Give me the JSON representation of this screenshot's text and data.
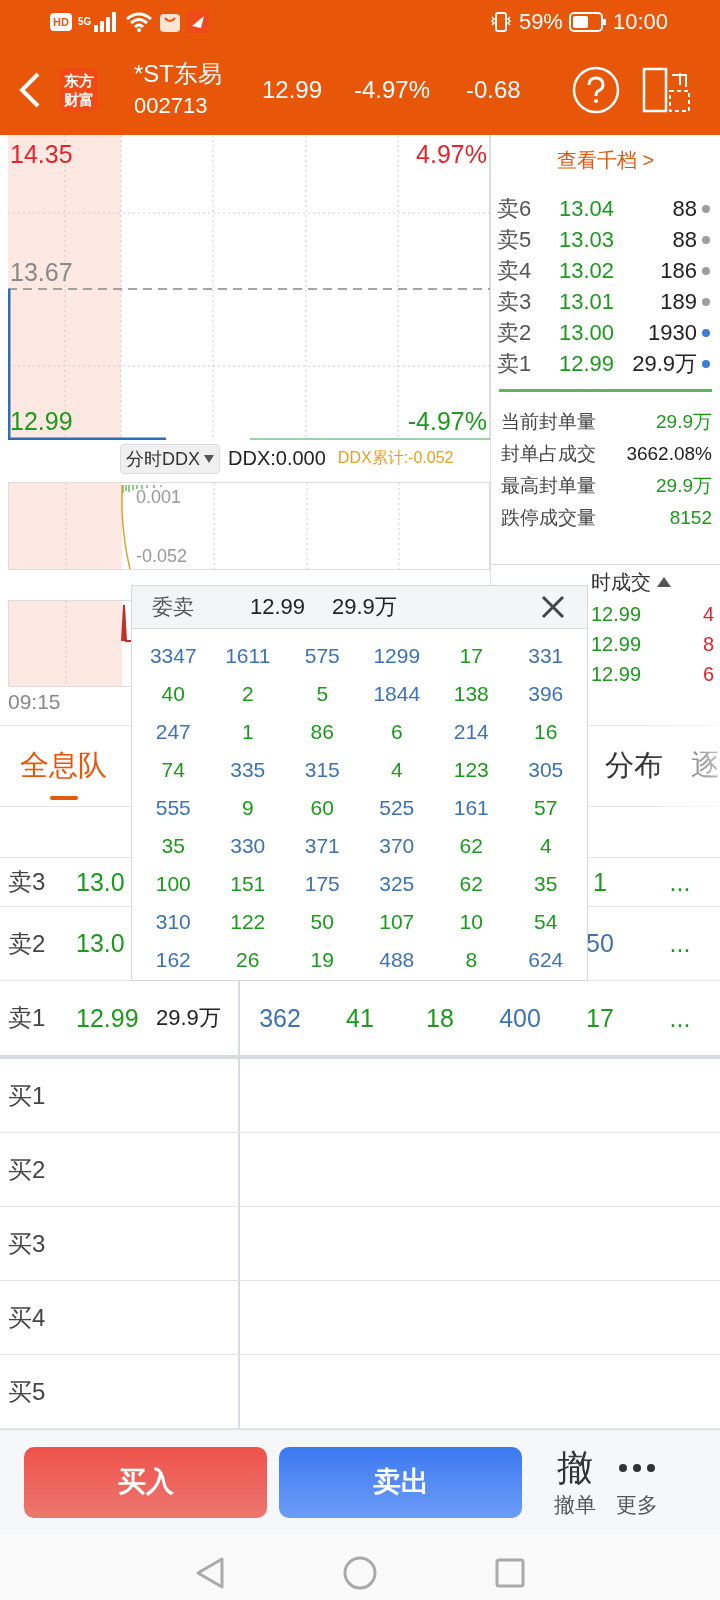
{
  "status_bar": {
    "hd_label": "HD",
    "network": "5G",
    "battery": "59%",
    "time": "10:00"
  },
  "header": {
    "logo_lines": [
      "东方",
      "财富"
    ],
    "name": "*ST东易",
    "code": "002713",
    "price": "12.99",
    "change_pct": "-4.97%",
    "change": "-0.68"
  },
  "price_chart": {
    "high": "14.35",
    "mid": "13.67",
    "low": "12.99",
    "high_pct": "4.97%",
    "low_pct": "-4.97%"
  },
  "ddx": {
    "selector": "分时DDX",
    "value": "DDX:0.000",
    "cumulative": "DDX累计:-0.052",
    "top_label": "0.001",
    "bottom_label": "-0.052"
  },
  "time_axis": {
    "start": "09:15"
  },
  "order_book": {
    "link": "查看千档 >",
    "asks": [
      {
        "label": "卖6",
        "price": "13.04",
        "volume": "88",
        "color": "#9e9e9e"
      },
      {
        "label": "卖5",
        "price": "13.03",
        "volume": "88",
        "color": "#9e9e9e"
      },
      {
        "label": "卖4",
        "price": "13.02",
        "volume": "186",
        "color": "#9e9e9e"
      },
      {
        "label": "卖3",
        "price": "13.01",
        "volume": "189",
        "color": "#9e9e9e"
      },
      {
        "label": "卖2",
        "price": "13.00",
        "volume": "1930",
        "color": "#3d7fd6"
      },
      {
        "label": "卖1",
        "price": "12.99",
        "volume": "29.9万",
        "color": "#3d7fd6"
      }
    ],
    "stats": [
      {
        "label": "当前封单量",
        "value": "29.9万",
        "kind": "green"
      },
      {
        "label": "封单占成交",
        "value": "3662.08%",
        "kind": "plain"
      },
      {
        "label": "最高封单量",
        "value": "29.9万",
        "kind": "green"
      },
      {
        "label": "跌停成交量",
        "value": "8152",
        "kind": "green"
      }
    ]
  },
  "trades": {
    "header": "时成交",
    "rows": [
      {
        "price": "12.99",
        "volume": "4"
      },
      {
        "price": "12.99",
        "volume": "8"
      },
      {
        "price": "12.99",
        "volume": "6"
      }
    ]
  },
  "tabs": [
    {
      "label": "全息队",
      "selected": true
    },
    {
      "label": "分布",
      "selected": false
    },
    {
      "label": "逐",
      "selected": false
    }
  ],
  "queue": [
    {
      "label": "卖3",
      "price": "13.0",
      "orders": [
        {
          "text": "1",
          "color": "#1c9a1c"
        },
        {
          "text": "...",
          "color": "#1c9a1c"
        }
      ]
    },
    {
      "label": "卖2",
      "price": "13.0",
      "orders": [
        {
          "text": "50",
          "color": "#3d73b5"
        },
        {
          "text": "...",
          "color": "#1c9a1c"
        }
      ]
    },
    {
      "label": "卖1",
      "price": "12.99",
      "volume": "29.9万",
      "orders": [
        {
          "text": "362",
          "color": "#3d73b5"
        },
        {
          "text": "41",
          "color": "#1c9a1c"
        },
        {
          "text": "18",
          "color": "#1c9a1c"
        },
        {
          "text": "400",
          "color": "#3d73b5"
        },
        {
          "text": "17",
          "color": "#1c9a1c"
        },
        {
          "text": "...",
          "color": "#1c9a1c"
        }
      ]
    },
    {
      "label": "买1"
    },
    {
      "label": "买2"
    },
    {
      "label": "买3"
    },
    {
      "label": "买4"
    },
    {
      "label": "买5"
    }
  ],
  "popup": {
    "title": "委卖",
    "price": "12.99",
    "volume": "29.9万",
    "rows": [
      [
        {
          "text": "3347",
          "color": "#3d73b5"
        },
        {
          "text": "1611",
          "color": "#3d73b5"
        },
        {
          "text": "575",
          "color": "#3d73b5"
        },
        {
          "text": "1299",
          "color": "#3d73b5"
        },
        {
          "text": "17",
          "color": "#1c9a1c"
        },
        {
          "text": "331",
          "color": "#3d73b5"
        }
      ],
      [
        {
          "text": "40",
          "color": "#1c9a1c"
        },
        {
          "text": "2",
          "color": "#1c9a1c"
        },
        {
          "text": "5",
          "color": "#1c9a1c"
        },
        {
          "text": "1844",
          "color": "#3d73b5"
        },
        {
          "text": "138",
          "color": "#1c9a1c"
        },
        {
          "text": "396",
          "color": "#3d73b5"
        }
      ],
      [
        {
          "text": "247",
          "color": "#3d73b5"
        },
        {
          "text": "1",
          "color": "#1c9a1c"
        },
        {
          "text": "86",
          "color": "#1c9a1c"
        },
        {
          "text": "6",
          "color": "#1c9a1c"
        },
        {
          "text": "214",
          "color": "#3d73b5"
        },
        {
          "text": "16",
          "color": "#1c9a1c"
        }
      ],
      [
        {
          "text": "74",
          "color": "#1c9a1c"
        },
        {
          "text": "335",
          "color": "#3d73b5"
        },
        {
          "text": "315",
          "color": "#3d73b5"
        },
        {
          "text": "4",
          "color": "#1c9a1c"
        },
        {
          "text": "123",
          "color": "#1c9a1c"
        },
        {
          "text": "305",
          "color": "#3d73b5"
        }
      ],
      [
        {
          "text": "555",
          "color": "#3d73b5"
        },
        {
          "text": "9",
          "color": "#1c9a1c"
        },
        {
          "text": "60",
          "color": "#1c9a1c"
        },
        {
          "text": "525",
          "color": "#3d73b5"
        },
        {
          "text": "161",
          "color": "#3d73b5"
        },
        {
          "text": "57",
          "color": "#1c9a1c"
        }
      ],
      [
        {
          "text": "35",
          "color": "#1c9a1c"
        },
        {
          "text": "330",
          "color": "#3d73b5"
        },
        {
          "text": "371",
          "color": "#3d73b5"
        },
        {
          "text": "370",
          "color": "#3d73b5"
        },
        {
          "text": "62",
          "color": "#1c9a1c"
        },
        {
          "text": "4",
          "color": "#1c9a1c"
        }
      ],
      [
        {
          "text": "100",
          "color": "#1c9a1c"
        },
        {
          "text": "151",
          "color": "#1c9a1c"
        },
        {
          "text": "175",
          "color": "#3d73b5"
        },
        {
          "text": "325",
          "color": "#3d73b5"
        },
        {
          "text": "62",
          "color": "#1c9a1c"
        },
        {
          "text": "35",
          "color": "#1c9a1c"
        }
      ],
      [
        {
          "text": "310",
          "color": "#3d73b5"
        },
        {
          "text": "122",
          "color": "#1c9a1c"
        },
        {
          "text": "50",
          "color": "#1c9a1c"
        },
        {
          "text": "107",
          "color": "#1c9a1c"
        },
        {
          "text": "10",
          "color": "#1c9a1c"
        },
        {
          "text": "54",
          "color": "#1c9a1c"
        }
      ],
      [
        {
          "text": "162",
          "color": "#3d73b5"
        },
        {
          "text": "26",
          "color": "#1c9a1c"
        },
        {
          "text": "19",
          "color": "#1c9a1c"
        },
        {
          "text": "488",
          "color": "#3d73b5"
        },
        {
          "text": "8",
          "color": "#1c9a1c"
        },
        {
          "text": "624",
          "color": "#3d73b5"
        }
      ]
    ]
  },
  "actions": {
    "buy": "买入",
    "sell": "卖出",
    "cancel_glyph": "撤",
    "cancel": "撤单",
    "more": "更多"
  }
}
